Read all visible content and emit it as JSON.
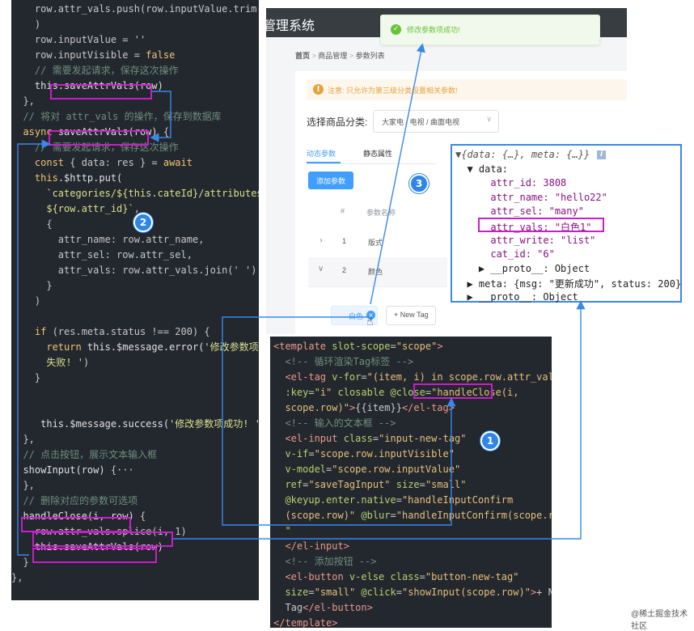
{
  "left_code": {
    "lines": [
      [
        [
          "pu",
          "    row.attr_vals.push(row.inputValue.trim()"
        ]
      ],
      [
        [
          "pu",
          "    )"
        ]
      ],
      [
        [
          "pu",
          "    row.inputValue = ''"
        ]
      ],
      [
        [
          "pu",
          "    row.inputVisible = "
        ],
        [
          "kw",
          "false"
        ]
      ],
      [
        [
          "cm",
          "    // 需要发起请求，保存这次操作"
        ]
      ],
      [
        [
          "pu",
          "    "
        ],
        [
          "fn",
          "this.saveAttrVals(row)"
        ]
      ],
      [
        [
          "pu",
          "  },"
        ]
      ],
      [
        [
          "cm",
          "  // 将对 attr_vals 的操作，保存到数据库"
        ]
      ],
      [
        [
          "kw",
          "  async "
        ],
        [
          "fn",
          "saveAttrVals(row)"
        ],
        [
          "pu",
          " {"
        ]
      ],
      [
        [
          "cm",
          "    // 需要发起请求，保存这次操作"
        ]
      ],
      [
        [
          "kw",
          "    const"
        ],
        [
          "pu",
          " { data: res } = "
        ],
        [
          "kw",
          "await"
        ]
      ],
      [
        [
          "pu",
          "    "
        ],
        [
          "kw",
          "this"
        ],
        [
          "fn",
          ".$http.put("
        ]
      ],
      [
        [
          "str",
          "      `categories/${this.cateId}/attributes/"
        ]
      ],
      [
        [
          "str",
          "      ${row.attr_id}`"
        ],
        [
          "pu",
          ","
        ]
      ],
      [
        [
          "pu",
          "      {"
        ]
      ],
      [
        [
          "pu",
          "        attr_name: row.attr_name,"
        ]
      ],
      [
        [
          "pu",
          "        attr_sel: row.attr_sel,"
        ]
      ],
      [
        [
          "pu",
          "        attr_vals: row.attr_vals.join(' ')"
        ]
      ],
      [
        [
          "pu",
          "      }"
        ]
      ],
      [
        [
          "pu",
          "    )"
        ]
      ],
      [
        [
          "pu",
          ""
        ]
      ],
      [
        [
          "kw",
          "    if"
        ],
        [
          "pu",
          " (res.meta.status !== 200) {"
        ]
      ],
      [
        [
          "kw",
          "      return "
        ],
        [
          "fn",
          "this.$message.error("
        ],
        [
          "str",
          "'修改参数项"
        ]
      ],
      [
        [
          "str",
          "      失败! '"
        ],
        [
          "pu",
          ")"
        ]
      ],
      [
        [
          "pu",
          "    }"
        ]
      ],
      [
        [
          "pu",
          ""
        ]
      ],
      [
        [
          "pu",
          ""
        ]
      ],
      [
        [
          "pu",
          "     "
        ],
        [
          "fn",
          "this.$message.success("
        ],
        [
          "str",
          "'修改参数项成功! '"
        ],
        [
          "pu",
          ")"
        ]
      ],
      [
        [
          "pu",
          "  },"
        ]
      ],
      [
        [
          "cm",
          "  // 点击按钮，展示文本输入框"
        ]
      ],
      [
        [
          "fn",
          "  showInput(row)"
        ],
        [
          "pu",
          " {···"
        ]
      ],
      [
        [
          "pu",
          "  },"
        ]
      ],
      [
        [
          "cm",
          "  // 删除对应的参数可选项"
        ]
      ],
      [
        [
          "fn",
          "  handleClose(i, row)"
        ],
        [
          "pu",
          " {"
        ]
      ],
      [
        [
          "pu",
          "    row.attr_vals.splice(i, 1)"
        ]
      ],
      [
        [
          "pu",
          "    "
        ],
        [
          "fn",
          "this.saveAttrVals(row)"
        ]
      ],
      [
        [
          "pu",
          "  }"
        ]
      ],
      [
        [
          "pu",
          "},"
        ]
      ]
    ]
  },
  "app": {
    "title_fragment": "管理系统",
    "toast": "修改参数项成功!",
    "breadcrumb": [
      "首页",
      "商品管理",
      "参数列表"
    ],
    "alert": "注意: 只允许为第三级分类设置相关参数!",
    "cate_label": "选择商品分类:",
    "cate_value": "大家电 / 电视 / 曲面电视",
    "tabs": [
      "动态参数",
      "静态属性"
    ],
    "add_button": "添加参数",
    "table_headers": [
      "#",
      "参数名称"
    ],
    "rows": [
      {
        "index": "1",
        "name": "版式"
      },
      {
        "index": "2",
        "name": "颜色"
      }
    ],
    "tag": "白色",
    "new_tag_button": "+ New Tag"
  },
  "console": {
    "lines": [
      "▼{data: {…}, meta: {…}}",
      "  ▼ data:",
      "      attr_id: 3808",
      "      attr_name: \"hello22\"",
      "      attr_sel: \"many\"",
      "      attr_vals: \"白色1\"",
      "      attr_write: \"list\"",
      "      cat_id: \"6\"",
      "    ▶ __proto__: Object",
      "  ▶ meta: {msg: \"更新成功\", status: 200}",
      "  ▶ __proto__: Object"
    ],
    "info_icon": "i"
  },
  "template_code": {
    "lines": [
      [
        [
          "tag",
          "<template"
        ],
        [
          "attr",
          " slot-scope"
        ],
        [
          "pu",
          "="
        ],
        [
          "val",
          "\"scope\""
        ],
        [
          "tag",
          ">"
        ]
      ],
      [
        [
          "cm",
          "  <!-- 循环渲染Tag标签 -->"
        ]
      ],
      [
        [
          "tag",
          "  <el-tag"
        ],
        [
          "attr",
          " v-for"
        ],
        [
          "pu",
          "="
        ],
        [
          "val",
          "\"(item, i) in scope.row.attr_vals\""
        ]
      ],
      [
        [
          "attr",
          "  :key"
        ],
        [
          "pu",
          "="
        ],
        [
          "val",
          "\"i\""
        ],
        [
          "attr",
          " closable @close"
        ],
        [
          "pu",
          "="
        ],
        [
          "val",
          "\"handleClose(i,"
        ]
      ],
      [
        [
          "val",
          "  scope.row)\""
        ],
        [
          "tag",
          ">"
        ],
        [
          "pu",
          "{{item}}"
        ],
        [
          "tag",
          "</el-tag>"
        ]
      ],
      [
        [
          "cm",
          "  <!-- 输入的文本框 -->"
        ]
      ],
      [
        [
          "tag",
          "  <el-input"
        ],
        [
          "attr",
          " class"
        ],
        [
          "pu",
          "="
        ],
        [
          "val",
          "\"input-new-tag\""
        ]
      ],
      [
        [
          "attr",
          "  v-if"
        ],
        [
          "pu",
          "="
        ],
        [
          "val",
          "\"scope.row.inputVisible\""
        ]
      ],
      [
        [
          "attr",
          "  v-model"
        ],
        [
          "pu",
          "="
        ],
        [
          "val",
          "\"scope.row.inputValue\""
        ]
      ],
      [
        [
          "attr",
          "  ref"
        ],
        [
          "pu",
          "="
        ],
        [
          "val",
          "\"saveTagInput\""
        ],
        [
          "attr",
          " size"
        ],
        [
          "pu",
          "="
        ],
        [
          "val",
          "\"small\""
        ]
      ],
      [
        [
          "attr",
          "  @keyup.enter.native"
        ],
        [
          "pu",
          "="
        ],
        [
          "val",
          "\"handleInputConfirm"
        ]
      ],
      [
        [
          "val",
          "  (scope.row)\""
        ],
        [
          "attr",
          " @blur"
        ],
        [
          "pu",
          "="
        ],
        [
          "val",
          "\"handleInputConfirm(scope.row)"
        ]
      ],
      [
        [
          "val",
          "  \""
        ]
      ],
      [
        [
          "tag",
          "  </el-input>"
        ]
      ],
      [
        [
          "cm",
          "  <!-- 添加按钮 -->"
        ]
      ],
      [
        [
          "tag",
          "  <el-button"
        ],
        [
          "attr",
          " v-else class"
        ],
        [
          "pu",
          "="
        ],
        [
          "val",
          "\"button-new-tag\""
        ]
      ],
      [
        [
          "attr",
          "  size"
        ],
        [
          "pu",
          "="
        ],
        [
          "val",
          "\"small\""
        ],
        [
          "attr",
          " @click"
        ],
        [
          "pu",
          "="
        ],
        [
          "val",
          "\"showInput(scope.row)\""
        ],
        [
          "tag",
          ">"
        ],
        [
          "pu",
          "+ New"
        ]
      ],
      [
        [
          "pu",
          "  Tag"
        ],
        [
          "tag",
          "</el-button>"
        ]
      ],
      [
        [
          "tag",
          "</template>"
        ]
      ]
    ]
  },
  "badges": [
    "1",
    "2",
    "3"
  ],
  "watermark": "@稀土掘金技术社区"
}
